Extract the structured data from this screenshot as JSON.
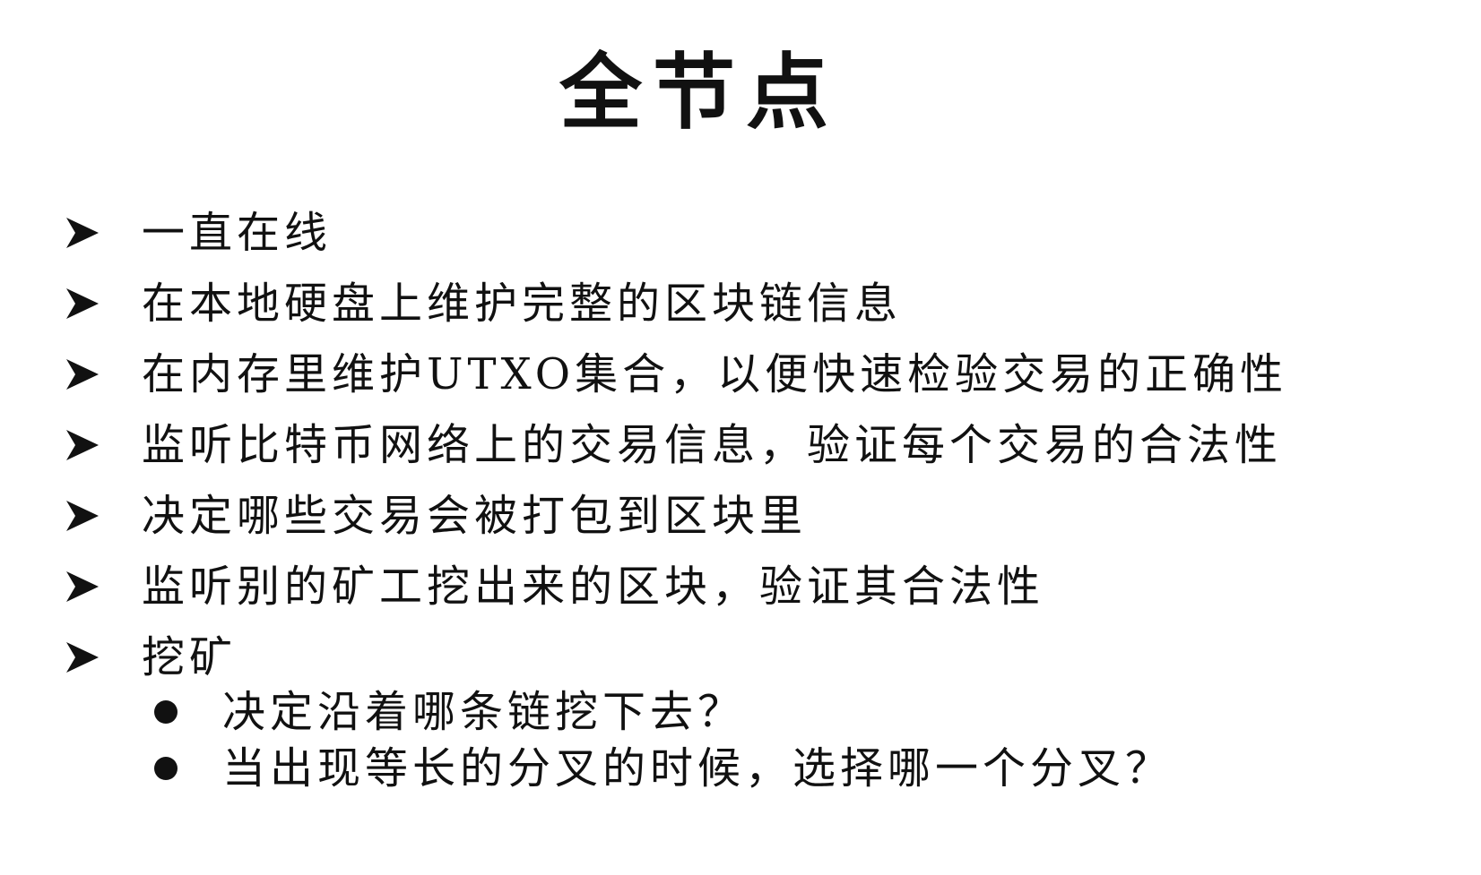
{
  "title": "全节点",
  "bullets": [
    {
      "text": "一直在线"
    },
    {
      "text": "在本地硬盘上维护完整的区块链信息"
    },
    {
      "text": "在内存里维护UTXO集合，以便快速检验交易的正确性"
    },
    {
      "text": "监听比特币网络上的交易信息，验证每个交易的合法性"
    },
    {
      "text": "决定哪些交易会被打包到区块里"
    },
    {
      "text": "监听别的矿工挖出来的区块，验证其合法性"
    },
    {
      "text": "挖矿"
    }
  ],
  "sub_bullets": [
    {
      "text": "决定沿着哪条链挖下去？"
    },
    {
      "text": "当出现等长的分叉的时候，选择哪一个分叉？"
    }
  ],
  "icons": {
    "bullet": "arrowhead-bullet-icon",
    "sub_bullet": "filled-circle-bullet-icon"
  }
}
